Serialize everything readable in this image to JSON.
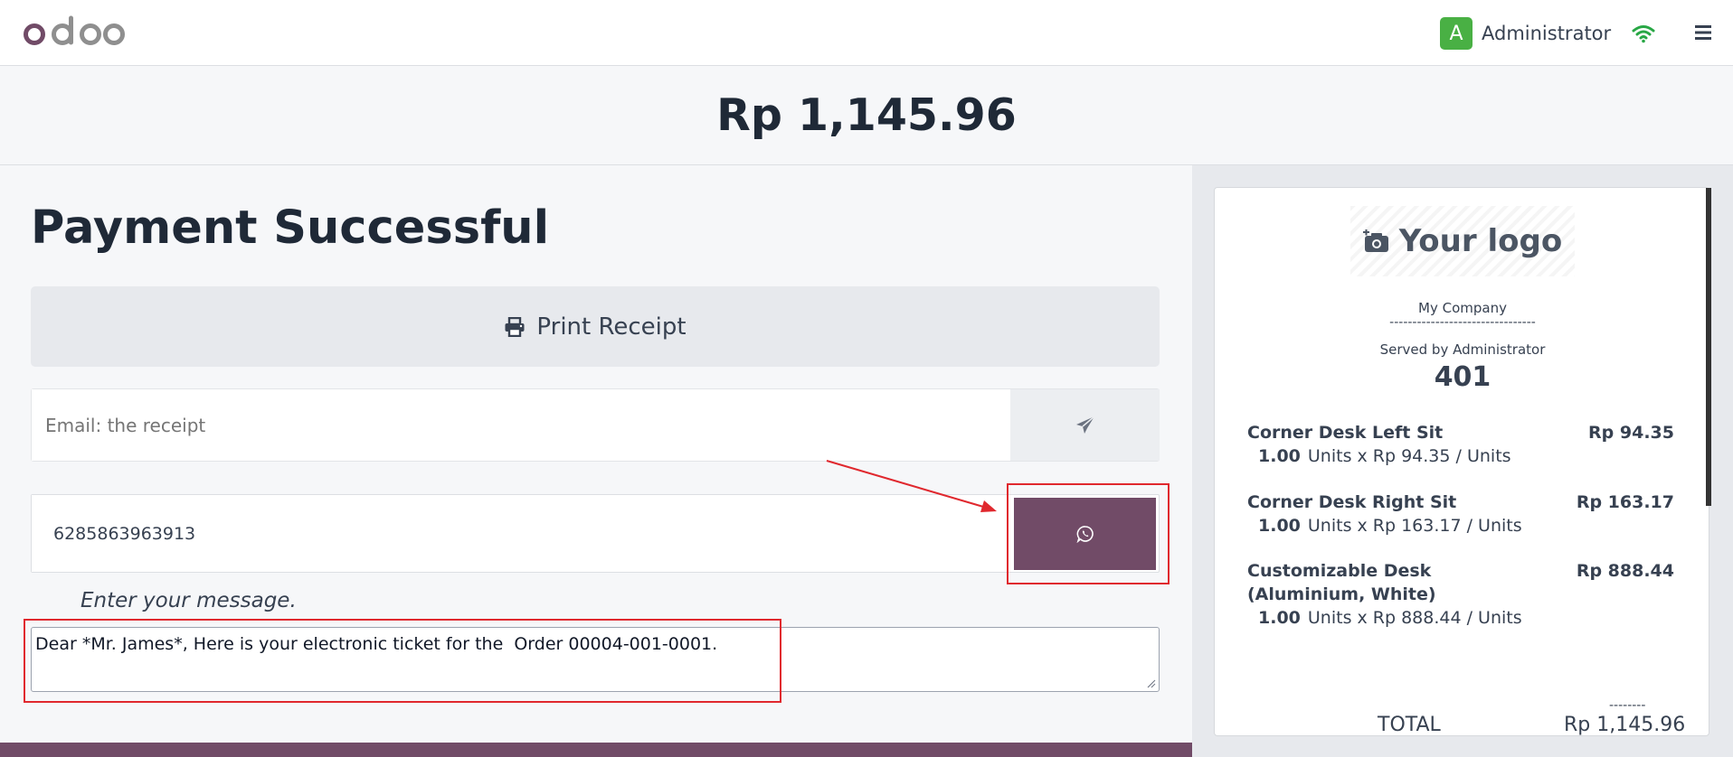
{
  "topbar": {
    "logo_text": "odoo",
    "user_initial": "A",
    "user_name": "Administrator",
    "wifi_icon": "wifi-icon",
    "menu_icon": "hamburger-menu-icon",
    "avatar_color": "#49b044"
  },
  "header": {
    "total_amount": "Rp 1,145.96"
  },
  "payment": {
    "title": "Payment Successful",
    "print_label": "Print Receipt",
    "email_placeholder": "Email: the receipt",
    "phone_value": "6285863963913",
    "message_label": "Enter your message.",
    "message_text": "Dear *Mr. James*, Here is your electronic ticket for the  Order 00004-001-0001.",
    "accent_color": "#714b67",
    "highlight_color": "#e0282e"
  },
  "receipt": {
    "logo_text": "Your logo",
    "company": "My Company",
    "dashes": "--------------------------------",
    "served_by": "Served by Administrator",
    "order_number": "401",
    "lines": [
      {
        "name": "Corner Desk Left Sit",
        "price": "Rp 94.35",
        "qty": "1.00",
        "detail": "Units x Rp 94.35 / Units"
      },
      {
        "name": "Corner Desk Right Sit",
        "price": "Rp 163.17",
        "qty": "1.00",
        "detail": "Units x Rp 163.17 / Units"
      },
      {
        "name": "Customizable Desk (Aluminium, White)",
        "price": "Rp 888.44",
        "qty": "1.00",
        "detail": "Units x Rp 888.44 / Units"
      }
    ],
    "total_dashes": "--------",
    "total_label": "TOTAL",
    "total_value": "Rp 1,145.96"
  }
}
